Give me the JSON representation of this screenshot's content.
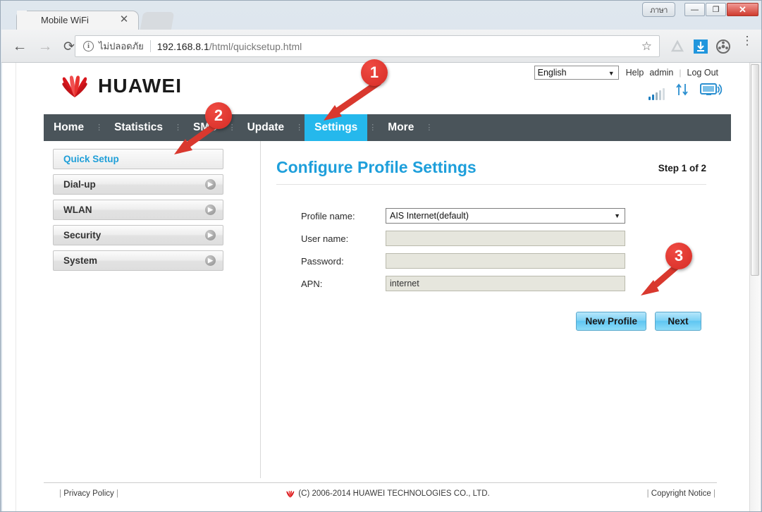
{
  "browser": {
    "tab": {
      "title": "Mobile WiFi",
      "close_icon": "close-icon"
    },
    "nav": {
      "back_icon": "back-arrow-icon",
      "forward_icon": "forward-arrow-icon",
      "reload_icon": "reload-icon"
    },
    "omnibox": {
      "info_icon": "info-circle-icon",
      "security_label": "ไม่ปลอดภัย",
      "url_host": "192.168.8.1",
      "url_path": "/html/quicksetup.html",
      "bookmark_icon": "star-icon"
    },
    "extensions": [
      "drive-icon",
      "download-icon",
      "film-reel-icon"
    ],
    "menu_icon": "kebab-menu-icon",
    "window_controls": {
      "thai_button": "ภาษา",
      "minimize": "—",
      "maximize": "❐",
      "close": "✕"
    }
  },
  "header": {
    "brand": "HUAWEI",
    "language": "English",
    "language_arrow": "▼",
    "links": [
      "Help",
      "admin",
      "Log Out"
    ],
    "status_icons": [
      "signal-bars-icon",
      "up-down-arrows-icon",
      "connected-device-icon"
    ]
  },
  "nav_menu": {
    "items": [
      {
        "label": "Home",
        "active": false
      },
      {
        "label": "Statistics",
        "active": false
      },
      {
        "label": "SMS",
        "active": false
      },
      {
        "label": "Update",
        "active": false
      },
      {
        "label": "Settings",
        "active": true
      },
      {
        "label": "More",
        "active": false
      }
    ]
  },
  "sidebar": {
    "items": [
      {
        "label": "Quick Setup",
        "active": true,
        "chevron": false
      },
      {
        "label": "Dial-up",
        "active": false,
        "chevron": true
      },
      {
        "label": "WLAN",
        "active": false,
        "chevron": true
      },
      {
        "label": "Security",
        "active": false,
        "chevron": true
      },
      {
        "label": "System",
        "active": false,
        "chevron": true
      }
    ]
  },
  "main": {
    "title": "Configure Profile Settings",
    "step": "Step 1 of 2",
    "fields": [
      {
        "label": "Profile name:",
        "type": "select",
        "value": "AIS Internet(default)",
        "arrow": "▼"
      },
      {
        "label": "User name:",
        "type": "input",
        "value": ""
      },
      {
        "label": "Password:",
        "type": "input",
        "value": ""
      },
      {
        "label": "APN:",
        "type": "input",
        "value": "internet"
      }
    ],
    "buttons": [
      {
        "label": "New Profile"
      },
      {
        "label": "Next"
      }
    ]
  },
  "footer": {
    "left": "Privacy Policy",
    "center": "(C) 2006-2014 HUAWEI TECHNOLOGIES CO., LTD.",
    "right": "Copyright Notice",
    "pipe": "|"
  },
  "annotations": [
    {
      "number": "1",
      "target": "settings-nav-tab"
    },
    {
      "number": "2",
      "target": "quick-setup-sidebar-item"
    },
    {
      "number": "3",
      "target": "new-profile-button"
    }
  ],
  "colors": {
    "accent": "#25b8ec",
    "title": "#1e9fdb",
    "navbar": "#4a545a",
    "annotation": "#d62d26",
    "brand_red": "#d8161c"
  }
}
